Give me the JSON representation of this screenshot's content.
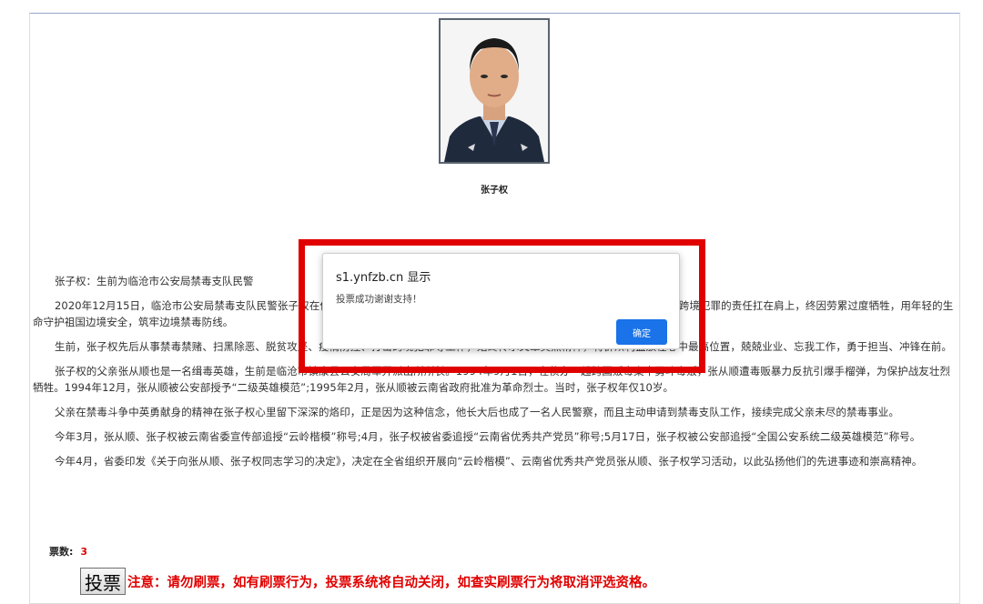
{
  "profile": {
    "name": "张子权"
  },
  "article": {
    "intro": "张子权：生前为临沧市公安局禁毒支队民警",
    "paragraphs": [
      "2020年12月15日，临沧市公安局禁毒支队民警张子权在侦办一起跨境毒品案件中，连续多日加班加点、熬夜办案，始终把全链条打击跨境犯罪的责任扛在肩上，终因劳累过度牺牲，用年轻的生命守护祖国边境安全，筑牢边境禁毒防线。",
      "生前，张子权先后从事禁毒禁赌、扫黑除恶、脱贫攻坚、疫情防控、打击跨境犯罪等工作，始终传承父辈英烈精神，将群众利益放在心中最高位置，兢兢业业、忘我工作，勇于担当、冲锋在前。",
      "张子权的父亲张从顺也是一名缉毒英雄，生前是临沧市镇康县公安局军弄派出所所长。1994年9月1日，在侦办一起跨国贩毒案中勇斗毒贩，张从顺遭毒贩暴力反抗引爆手榴弹，为保护战友壮烈牺牲。1994年12月，张从顺被公安部授予“二级英雄模范”;1995年2月，张从顺被云南省政府批准为革命烈士。当时，张子权年仅10岁。",
      "父亲在禁毒斗争中英勇献身的精神在张子权心里留下深深的烙印，正是因为这种信念，他长大后也成了一名人民警察，而且主动申请到禁毒支队工作，接续完成父亲未尽的禁毒事业。",
      "今年3月，张从顺、张子权被云南省委宣传部追授“云岭楷模”称号;4月，张子权被省委追授“云南省优秀共产党员”称号;5月17日，张子权被公安部追授“全国公安系统二级英雄模范”称号。",
      "今年4月，省委印发《关于向张从顺、张子权同志学习的决定》，决定在全省组织开展向“云岭楷模”、云南省优秀共产党员张从顺、张子权学习活动，以此弘扬他们的先进事迹和崇高精神。"
    ]
  },
  "vote": {
    "count_label": "票数:",
    "count": "3",
    "button_label": "投票",
    "warning": "注意：请勿刷票，如有刷票行为，投票系统将自动关闭，如查实刷票行为将取消评选资格。"
  },
  "dialog": {
    "title": "s1.ynfzb.cn 显示",
    "message": "投票成功谢谢支持！",
    "ok_label": "确定"
  },
  "colors": {
    "highlight": "#e00000",
    "button_blue": "#1a73e8",
    "warning_red": "#e00000"
  }
}
